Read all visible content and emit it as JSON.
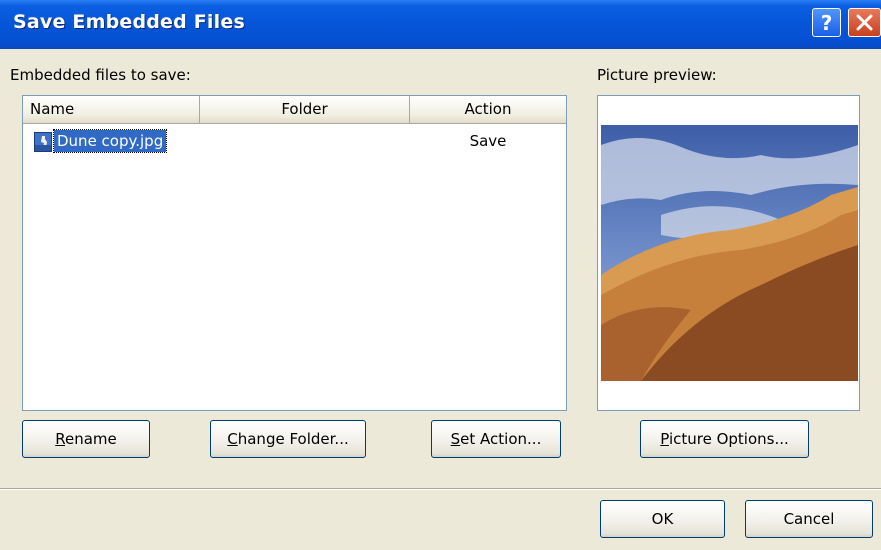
{
  "window": {
    "title": "Save Embedded Files"
  },
  "titlebar_buttons": {
    "help_label": "?",
    "close_label": "✕"
  },
  "files_section": {
    "label": "Embedded files to save:",
    "columns": [
      "Name",
      "Folder",
      "Action"
    ],
    "rows": [
      {
        "name": "Dune copy.jpg",
        "folder": "",
        "action": "Save",
        "selected": true,
        "icon": "image-file-icon"
      }
    ]
  },
  "preview_section": {
    "label": "Picture preview:"
  },
  "buttons": {
    "rename": {
      "mnemonic": "R",
      "rest": "ename"
    },
    "change_folder": {
      "mnemonic": "C",
      "rest": "hange Folder..."
    },
    "set_action": {
      "mnemonic": "S",
      "rest": "et Action..."
    },
    "picture_options": {
      "mnemonic": "P",
      "rest": "icture Options..."
    },
    "ok": "OK",
    "cancel": "Cancel"
  },
  "colors": {
    "titlebar": "#0550d2",
    "dialog_bg": "#ece9d8",
    "selection": "#316ac5",
    "close_button": "#c9401e"
  }
}
